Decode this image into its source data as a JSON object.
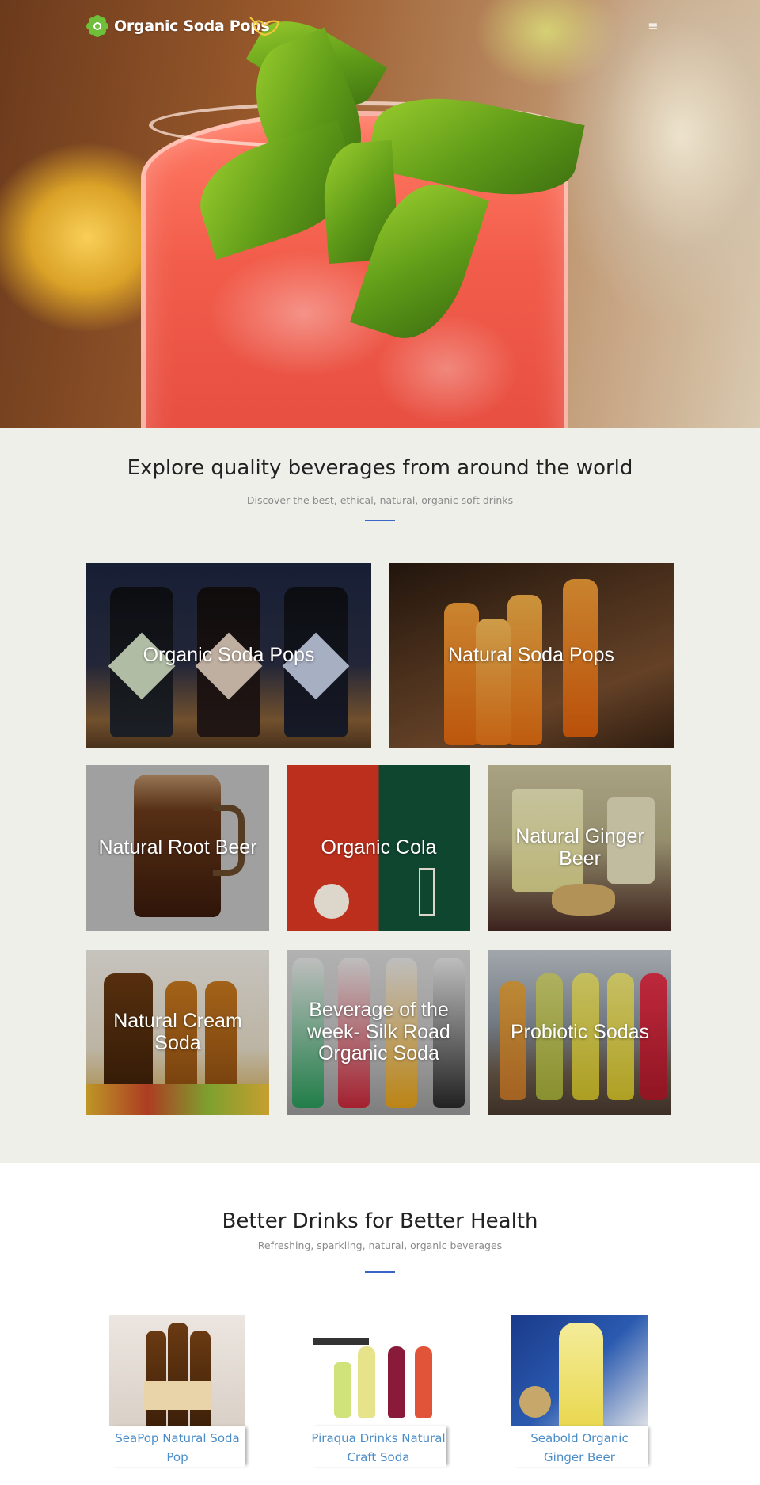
{
  "header": {
    "brand_name": "Organic Soda Pops",
    "logo_icon": "flower-icon",
    "bird_icon": "bird-icon",
    "menu_icon": "hamburger-menu-icon",
    "menu_glyph": "≡"
  },
  "explore": {
    "title": "Explore quality beverages from around the world",
    "subtitle": "Discover the best, ethical, natural, organic soft drinks",
    "categories": [
      {
        "label": "Organic Soda Pops"
      },
      {
        "label": "Natural Soda Pops"
      },
      {
        "label": "Natural Root Beer"
      },
      {
        "label": "Organic Cola"
      },
      {
        "label": "Natural Ginger Beer"
      },
      {
        "label": "Natural Cream Soda"
      },
      {
        "label": "Beverage of the week- Silk Road Organic Soda"
      },
      {
        "label": "Probiotic Sodas"
      }
    ]
  },
  "better": {
    "title": "Better Drinks for Better Health",
    "subtitle": "Refreshing, sparkling, natural, organic beverages",
    "products": [
      {
        "name": "SeaPop Natural Soda Pop"
      },
      {
        "name": "Piraqua Drinks Natural Craft Soda"
      },
      {
        "name": "Seabold Organic Ginger Beer"
      }
    ]
  },
  "colors": {
    "accent_rule": "#3a66c8",
    "link_blue": "#4a8cc8",
    "section_bg": "#efefea"
  }
}
